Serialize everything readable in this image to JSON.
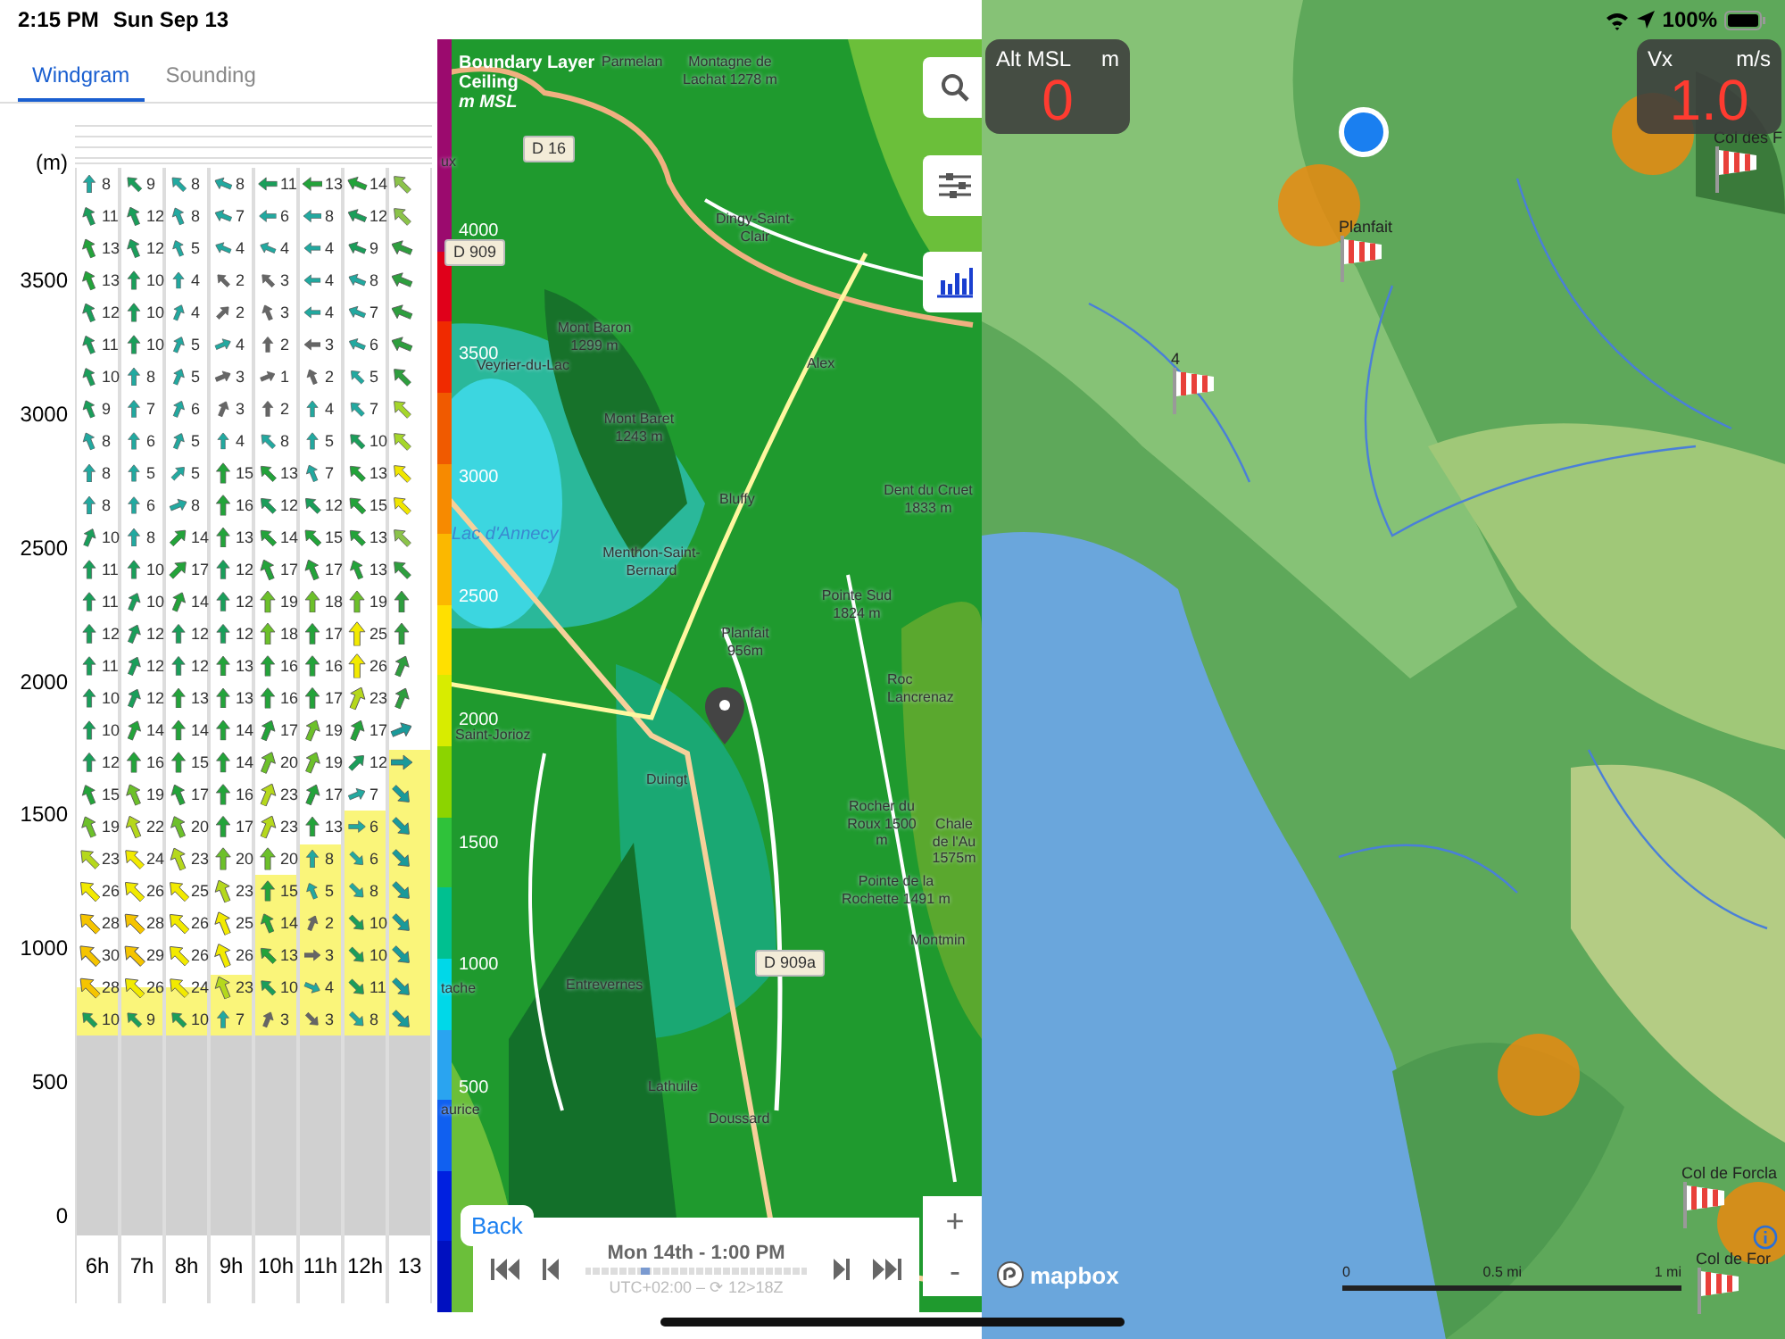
{
  "status_bar": {
    "time": "2:15 PM",
    "date": "Sun Sep 13",
    "battery": "100%"
  },
  "tabs": [
    {
      "label": "Windgram",
      "selected": true
    },
    {
      "label": "Sounding",
      "selected": false
    }
  ],
  "windgram": {
    "unit_label": "(m)",
    "altitude_labels": [
      "3500",
      "3000",
      "2500",
      "2000",
      "1500",
      "1000",
      "500",
      "0"
    ],
    "hours": [
      {
        "label": "6h",
        "level": 0.055
      },
      {
        "label": "7h",
        "level": 0.055
      },
      {
        "label": "8h",
        "level": 0.055
      },
      {
        "label": "9h",
        "level": 0.07
      },
      {
        "label": "10h",
        "level": 0.185
      },
      {
        "label": "11h",
        "level": 0.22
      },
      {
        "label": "12h",
        "level": 0.26
      },
      {
        "label": "13",
        "level": 0.33
      }
    ],
    "rows": [
      [
        {
          "speed": "8",
          "kind": "N"
        },
        {
          "speed": "9",
          "kind": "NW"
        },
        {
          "speed": "8",
          "kind": "NW"
        },
        {
          "speed": "8",
          "kind": "WNW"
        },
        {
          "speed": "11",
          "kind": "W"
        },
        {
          "speed": "13",
          "kind": "W"
        },
        {
          "speed": "14",
          "kind": "WNW"
        },
        {
          "kind": "NW",
          "color": "#8bc34a"
        }
      ],
      [
        {
          "speed": "11",
          "kind": "NNW"
        },
        {
          "speed": "12",
          "kind": "NNW"
        },
        {
          "speed": "8",
          "kind": "NNW"
        },
        {
          "speed": "7",
          "kind": "WNW"
        },
        {
          "speed": "6",
          "kind": "W"
        },
        {
          "speed": "8",
          "kind": "W"
        },
        {
          "speed": "12",
          "kind": "WNW"
        },
        {
          "kind": "NW",
          "color": "#8bc34a"
        }
      ],
      [
        {
          "speed": "13",
          "kind": "NNW"
        },
        {
          "speed": "12",
          "kind": "NNW"
        },
        {
          "speed": "5",
          "kind": "NNW"
        },
        {
          "speed": "4",
          "kind": "WNW"
        },
        {
          "speed": "4",
          "kind": "WNW"
        },
        {
          "speed": "4",
          "kind": "W"
        },
        {
          "speed": "9",
          "kind": "WNW"
        },
        {
          "kind": "WNW",
          "color": "#2e9e3e"
        }
      ],
      [
        {
          "speed": "13",
          "kind": "NNW"
        },
        {
          "speed": "10",
          "kind": "N"
        },
        {
          "speed": "4",
          "kind": "N"
        },
        {
          "speed": "2",
          "kind": "NW"
        },
        {
          "speed": "3",
          "kind": "NW"
        },
        {
          "speed": "4",
          "kind": "W"
        },
        {
          "speed": "8",
          "kind": "WNW"
        },
        {
          "kind": "WNW",
          "color": "#2e9e3e"
        }
      ],
      [
        {
          "speed": "12",
          "kind": "NNW"
        },
        {
          "speed": "10",
          "kind": "N"
        },
        {
          "speed": "4",
          "kind": "NNE"
        },
        {
          "speed": "2",
          "kind": "NE"
        },
        {
          "speed": "3",
          "kind": "NNW"
        },
        {
          "speed": "4",
          "kind": "W"
        },
        {
          "speed": "7",
          "kind": "WNW"
        },
        {
          "kind": "WNW",
          "color": "#2e9e3e"
        }
      ],
      [
        {
          "speed": "11",
          "kind": "NNW"
        },
        {
          "speed": "10",
          "kind": "N"
        },
        {
          "speed": "5",
          "kind": "NNE"
        },
        {
          "speed": "4",
          "kind": "ENE"
        },
        {
          "speed": "2",
          "kind": "N"
        },
        {
          "speed": "3",
          "kind": "W"
        },
        {
          "speed": "6",
          "kind": "WNW"
        },
        {
          "kind": "WNW",
          "color": "#2e9e3e"
        }
      ],
      [
        {
          "speed": "10",
          "kind": "NNW"
        },
        {
          "speed": "8",
          "kind": "N"
        },
        {
          "speed": "5",
          "kind": "NNE"
        },
        {
          "speed": "3",
          "kind": "ENE"
        },
        {
          "speed": "1",
          "kind": "ENE"
        },
        {
          "speed": "2",
          "kind": "NNW"
        },
        {
          "speed": "5",
          "kind": "NW"
        },
        {
          "kind": "NW",
          "color": "#2e9e3e"
        }
      ],
      [
        {
          "speed": "9",
          "kind": "NNW"
        },
        {
          "speed": "7",
          "kind": "N"
        },
        {
          "speed": "6",
          "kind": "NNE"
        },
        {
          "speed": "3",
          "kind": "NNE"
        },
        {
          "speed": "2",
          "kind": "N"
        },
        {
          "speed": "4",
          "kind": "N"
        },
        {
          "speed": "7",
          "kind": "NW"
        },
        {
          "kind": "NW",
          "color": "#a5d62b"
        }
      ],
      [
        {
          "speed": "8",
          "kind": "NNW"
        },
        {
          "speed": "6",
          "kind": "N"
        },
        {
          "speed": "5",
          "kind": "NNE"
        },
        {
          "speed": "4",
          "kind": "N"
        },
        {
          "speed": "8",
          "kind": "NW"
        },
        {
          "speed": "5",
          "kind": "N"
        },
        {
          "speed": "10",
          "kind": "NW"
        },
        {
          "kind": "NW",
          "color": "#a5d62b"
        }
      ],
      [
        {
          "speed": "8",
          "kind": "N"
        },
        {
          "speed": "5",
          "kind": "N"
        },
        {
          "speed": "5",
          "kind": "NE"
        },
        {
          "speed": "15",
          "kind": "N"
        },
        {
          "speed": "13",
          "kind": "NW"
        },
        {
          "speed": "7",
          "kind": "NNW"
        },
        {
          "speed": "13",
          "kind": "NW"
        },
        {
          "kind": "NW",
          "color": "#f0e600"
        }
      ],
      [
        {
          "speed": "8",
          "kind": "N"
        },
        {
          "speed": "6",
          "kind": "N"
        },
        {
          "speed": "8",
          "kind": "ENE"
        },
        {
          "speed": "16",
          "kind": "N"
        },
        {
          "speed": "12",
          "kind": "NW"
        },
        {
          "speed": "12",
          "kind": "NW"
        },
        {
          "speed": "15",
          "kind": "NW"
        },
        {
          "kind": "NW",
          "color": "#f0e600"
        }
      ],
      [
        {
          "speed": "10",
          "kind": "NNE"
        },
        {
          "speed": "8",
          "kind": "N"
        },
        {
          "speed": "14",
          "kind": "NE"
        },
        {
          "speed": "13",
          "kind": "N"
        },
        {
          "speed": "14",
          "kind": "NW"
        },
        {
          "speed": "15",
          "kind": "NW"
        },
        {
          "speed": "13",
          "kind": "NW"
        },
        {
          "kind": "NW",
          "color": "#8bc34a"
        }
      ],
      [
        {
          "speed": "11",
          "kind": "N"
        },
        {
          "speed": "10",
          "kind": "N"
        },
        {
          "speed": "17",
          "kind": "NE"
        },
        {
          "speed": "12",
          "kind": "N"
        },
        {
          "speed": "17",
          "kind": "NNW"
        },
        {
          "speed": "17",
          "kind": "NNW"
        },
        {
          "speed": "13",
          "kind": "NNW"
        },
        {
          "kind": "NW",
          "color": "#2e9e3e"
        }
      ],
      [
        {
          "speed": "11",
          "kind": "N"
        },
        {
          "speed": "10",
          "kind": "NNE"
        },
        {
          "speed": "14",
          "kind": "NNE"
        },
        {
          "speed": "12",
          "kind": "N"
        },
        {
          "speed": "19",
          "kind": "N"
        },
        {
          "speed": "18",
          "kind": "N"
        },
        {
          "speed": "19",
          "kind": "N"
        },
        {
          "kind": "N",
          "color": "#2e9e3e"
        }
      ],
      [
        {
          "speed": "12",
          "kind": "N"
        },
        {
          "speed": "12",
          "kind": "NNE"
        },
        {
          "speed": "12",
          "kind": "N"
        },
        {
          "speed": "12",
          "kind": "N"
        },
        {
          "speed": "18",
          "kind": "N"
        },
        {
          "speed": "17",
          "kind": "N"
        },
        {
          "speed": "25",
          "kind": "N"
        },
        {
          "kind": "N",
          "color": "#2e9e3e"
        }
      ],
      [
        {
          "speed": "11",
          "kind": "N"
        },
        {
          "speed": "12",
          "kind": "NNE"
        },
        {
          "speed": "12",
          "kind": "N"
        },
        {
          "speed": "13",
          "kind": "N"
        },
        {
          "speed": "16",
          "kind": "N"
        },
        {
          "speed": "16",
          "kind": "N"
        },
        {
          "speed": "26",
          "kind": "N"
        },
        {
          "kind": "NNE",
          "color": "#2e9e3e"
        }
      ],
      [
        {
          "speed": "10",
          "kind": "N"
        },
        {
          "speed": "12",
          "kind": "NNE"
        },
        {
          "speed": "13",
          "kind": "N"
        },
        {
          "speed": "13",
          "kind": "N"
        },
        {
          "speed": "16",
          "kind": "N"
        },
        {
          "speed": "17",
          "kind": "N"
        },
        {
          "speed": "23",
          "kind": "NNE"
        },
        {
          "kind": "NNE",
          "color": "#2e9e3e"
        }
      ],
      [
        {
          "speed": "10",
          "kind": "N"
        },
        {
          "speed": "14",
          "kind": "NNE"
        },
        {
          "speed": "14",
          "kind": "N"
        },
        {
          "speed": "14",
          "kind": "N"
        },
        {
          "speed": "17",
          "kind": "NNE"
        },
        {
          "speed": "19",
          "kind": "NNE"
        },
        {
          "speed": "17",
          "kind": "NNE"
        },
        {
          "kind": "ENE",
          "color": "#1a9a9a"
        }
      ],
      [
        {
          "speed": "12",
          "kind": "N"
        },
        {
          "speed": "16",
          "kind": "N"
        },
        {
          "speed": "15",
          "kind": "N"
        },
        {
          "speed": "14",
          "kind": "N"
        },
        {
          "speed": "20",
          "kind": "NNE"
        },
        {
          "speed": "19",
          "kind": "NNE"
        },
        {
          "speed": "12",
          "kind": "NE"
        },
        {
          "kind": "E",
          "color": "#1a9a9a"
        }
      ],
      [
        {
          "speed": "15",
          "kind": "NNW"
        },
        {
          "speed": "19",
          "kind": "NNW"
        },
        {
          "speed": "17",
          "kind": "NNW"
        },
        {
          "speed": "16",
          "kind": "N"
        },
        {
          "speed": "23",
          "kind": "NNE"
        },
        {
          "speed": "17",
          "kind": "NNE"
        },
        {
          "speed": "7",
          "kind": "ENE"
        },
        {
          "kind": "SE",
          "color": "#1a9a9a"
        }
      ],
      [
        {
          "speed": "19",
          "kind": "NNW"
        },
        {
          "speed": "22",
          "kind": "NNW"
        },
        {
          "speed": "20",
          "kind": "NNW"
        },
        {
          "speed": "17",
          "kind": "N"
        },
        {
          "speed": "23",
          "kind": "NNE"
        },
        {
          "speed": "13",
          "kind": "N"
        },
        {
          "speed": "6",
          "kind": "E"
        },
        {
          "kind": "SE",
          "color": "#1a9a9a"
        }
      ],
      [
        {
          "speed": "23",
          "kind": "NW"
        },
        {
          "speed": "24",
          "kind": "NW"
        },
        {
          "speed": "23",
          "kind": "NNW"
        },
        {
          "speed": "20",
          "kind": "N"
        },
        {
          "speed": "20",
          "kind": "N"
        },
        {
          "speed": "8",
          "kind": "N"
        },
        {
          "speed": "6",
          "kind": "SE"
        },
        {
          "kind": "SE",
          "color": "#1a9a9a"
        }
      ],
      [
        {
          "speed": "26",
          "kind": "NW"
        },
        {
          "speed": "26",
          "kind": "NW"
        },
        {
          "speed": "25",
          "kind": "NW"
        },
        {
          "speed": "23",
          "kind": "NNW"
        },
        {
          "speed": "15",
          "kind": "N"
        },
        {
          "speed": "5",
          "kind": "NNW"
        },
        {
          "speed": "8",
          "kind": "SE"
        },
        {
          "kind": "SE",
          "color": "#1a9a9a"
        }
      ],
      [
        {
          "speed": "28",
          "kind": "NW"
        },
        {
          "speed": "28",
          "kind": "NW"
        },
        {
          "speed": "26",
          "kind": "NW"
        },
        {
          "speed": "25",
          "kind": "NNW"
        },
        {
          "speed": "14",
          "kind": "NNW"
        },
        {
          "speed": "2",
          "kind": "NNE"
        },
        {
          "speed": "10",
          "kind": "SE"
        },
        {
          "kind": "SE",
          "color": "#1a9a9a"
        }
      ],
      [
        {
          "speed": "30",
          "kind": "NW"
        },
        {
          "speed": "29",
          "kind": "NW"
        },
        {
          "speed": "26",
          "kind": "NW"
        },
        {
          "speed": "26",
          "kind": "NNW"
        },
        {
          "speed": "13",
          "kind": "NW"
        },
        {
          "speed": "3",
          "kind": "E"
        },
        {
          "speed": "10",
          "kind": "SE"
        },
        {
          "kind": "SE",
          "color": "#1a9a9a"
        }
      ],
      [
        {
          "speed": "28",
          "kind": "NW"
        },
        {
          "speed": "26",
          "kind": "NW"
        },
        {
          "speed": "24",
          "kind": "NW"
        },
        {
          "speed": "23",
          "kind": "NNW"
        },
        {
          "speed": "10",
          "kind": "NW"
        },
        {
          "speed": "4",
          "kind": "ESE"
        },
        {
          "speed": "11",
          "kind": "SE"
        },
        {
          "kind": "SE",
          "color": "#1a9a9a"
        }
      ],
      [
        {
          "speed": "10",
          "kind": "NW"
        },
        {
          "speed": "9",
          "kind": "NW"
        },
        {
          "speed": "10",
          "kind": "NW"
        },
        {
          "speed": "7",
          "kind": "N"
        },
        {
          "speed": "3",
          "kind": "NNE"
        },
        {
          "speed": "3",
          "kind": "SE"
        },
        {
          "speed": "8",
          "kind": "SE"
        },
        {
          "kind": "SE",
          "color": "#1a9a9a"
        }
      ]
    ]
  },
  "forecast_map": {
    "legend_title": "Boundary Layer Ceiling",
    "legend_unit": "m MSL",
    "scale_labels": [
      "4000",
      "3500",
      "3000",
      "2500",
      "2000",
      "1500",
      "1000",
      "500"
    ],
    "labels": [
      {
        "text": "Parmelan",
        "kind": "place"
      },
      {
        "text": "Montagne de Lachat 1278 m",
        "kind": "peak"
      },
      {
        "text": "D 16",
        "kind": "road"
      },
      {
        "text": "ux",
        "kind": "place"
      },
      {
        "text": "D 909",
        "kind": "road"
      },
      {
        "text": "Dingy-Saint-Clair",
        "kind": "place"
      },
      {
        "text": "Mont Baron 1299 m",
        "kind": "peak"
      },
      {
        "text": "Veyrier-du-Lac",
        "kind": "place"
      },
      {
        "text": "Mont Baret 1243 m",
        "kind": "peak"
      },
      {
        "text": "Alex",
        "kind": "place"
      },
      {
        "text": "Bluffy",
        "kind": "place"
      },
      {
        "text": "Lac d'Annecy",
        "kind": "water"
      },
      {
        "text": "Menthon-Saint-Bernard",
        "kind": "place"
      },
      {
        "text": "Dent du Cruet 1833 m",
        "kind": "peak"
      },
      {
        "text": "Pointe Sud 1824 m",
        "kind": "peak"
      },
      {
        "text": "Planfait 956m",
        "kind": "place"
      },
      {
        "text": "Roc Lancrenaz",
        "kind": "place"
      },
      {
        "text": "Saint-Jorioz",
        "kind": "place"
      },
      {
        "text": "Duingt",
        "kind": "place"
      },
      {
        "text": "Rocher du Roux 1500 m",
        "kind": "peak"
      },
      {
        "text": "Chale de l'Au 1575m",
        "kind": "place"
      },
      {
        "text": "Pointe de la Rochette 1491 m",
        "kind": "peak"
      },
      {
        "text": "Montmin",
        "kind": "place"
      },
      {
        "text": "D 909a",
        "kind": "road"
      },
      {
        "text": "Entrevernes",
        "kind": "place"
      },
      {
        "text": "tache",
        "kind": "place"
      },
      {
        "text": "Lathuile",
        "kind": "place"
      },
      {
        "text": "Doussard",
        "kind": "place"
      },
      {
        "text": "aurice",
        "kind": "place"
      }
    ],
    "zoom_in": "+",
    "zoom_out": "-",
    "timeline": {
      "back": "Back",
      "date": "Mon 14th - 1:00 PM",
      "zone": "UTC+02:00 – ⟳ 12>18Z",
      "level": 0.25
    }
  },
  "flight_map": {
    "instruments": [
      {
        "label": "Alt MSL",
        "unit": "m",
        "value": "0"
      },
      {
        "label": "Vx",
        "unit": "m/s",
        "value": "1.0"
      }
    ],
    "sites": [
      {
        "name": "Planfait"
      },
      {
        "name": "4"
      },
      {
        "name": "Col des F"
      },
      {
        "name": "Col de Forcla"
      },
      {
        "name": "Col de For"
      }
    ],
    "attribution": "mapbox",
    "scale": [
      "0",
      "0.5 mi",
      "1 mi"
    ]
  }
}
